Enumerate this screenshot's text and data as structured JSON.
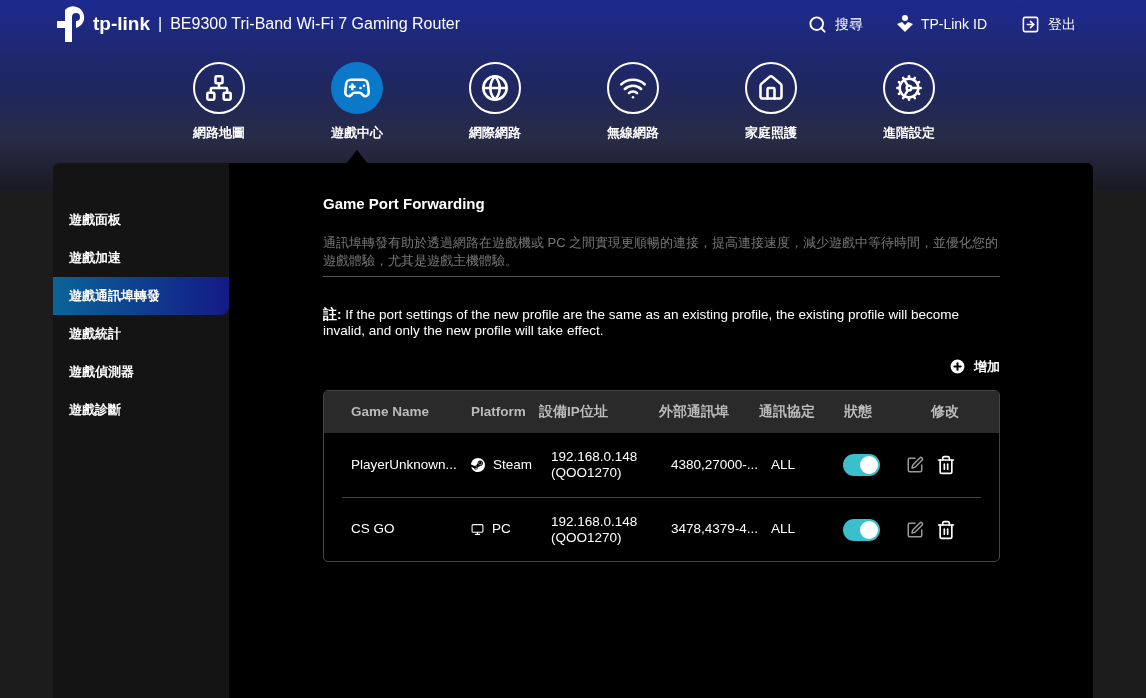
{
  "header": {
    "logo": "tp-link",
    "separator": "|",
    "title": "BE9300 Tri-Band Wi-Fi 7 Gaming Router",
    "links": [
      {
        "kind": "search",
        "label": "搜尋"
      },
      {
        "kind": "account",
        "label": "TP-Link ID"
      },
      {
        "kind": "logout",
        "label": "登出"
      }
    ]
  },
  "nav": [
    {
      "kind": "network-map",
      "label": "網路地圖",
      "selected": false
    },
    {
      "kind": "gaming",
      "label": "遊戲中心",
      "selected": true
    },
    {
      "kind": "internet",
      "label": "網際網路",
      "selected": false
    },
    {
      "kind": "wireless",
      "label": "無線網路",
      "selected": false
    },
    {
      "kind": "home-care",
      "label": "家庭照護",
      "selected": false
    },
    {
      "kind": "advanced",
      "label": "進階設定",
      "selected": false
    }
  ],
  "sidebar": {
    "items": [
      {
        "label": "遊戲面板",
        "selected": false
      },
      {
        "label": "遊戲加速",
        "selected": false
      },
      {
        "label": "遊戲通訊埠轉發",
        "selected": true
      },
      {
        "label": "遊戲統計",
        "selected": false
      },
      {
        "label": "遊戲偵測器",
        "selected": false
      },
      {
        "label": "遊戲診斷",
        "selected": false
      }
    ]
  },
  "section": {
    "title": "Game Port Forwarding",
    "description": "通訊埠轉發有助於透過網路在遊戲機或 PC 之間實現更順暢的連接，提高連接速度，減少遊戲中等待時間，並優化您的遊戲體驗，尤其是遊戲主機體驗。",
    "note": "**註:** If the port settings of the new profile are the same as an existing profile, the existing profile will become invalid, and only the new profile will take effect.",
    "add_button": "增加"
  },
  "table": {
    "columns": [
      "Game Name",
      "Platform",
      "設備IP位址",
      "外部通訊埠",
      "通訊協定",
      "狀態",
      "修改"
    ],
    "rows": [
      {
        "game_name": "PlayerUnknown...",
        "platform": {
          "kind": "steam",
          "label": "Steam"
        },
        "ip": "192.168.0.148",
        "device": "(QOO1270)",
        "external_port": "4380,27000-...",
        "protocol": "ALL",
        "on": true
      },
      {
        "game_name": "CS GO",
        "platform": {
          "kind": "pc",
          "label": "PC"
        },
        "ip": "192.168.0.148",
        "device": "(QOO1270)",
        "external_port": "3478,4379-4...",
        "protocol": "ALL",
        "on": true
      }
    ]
  }
}
